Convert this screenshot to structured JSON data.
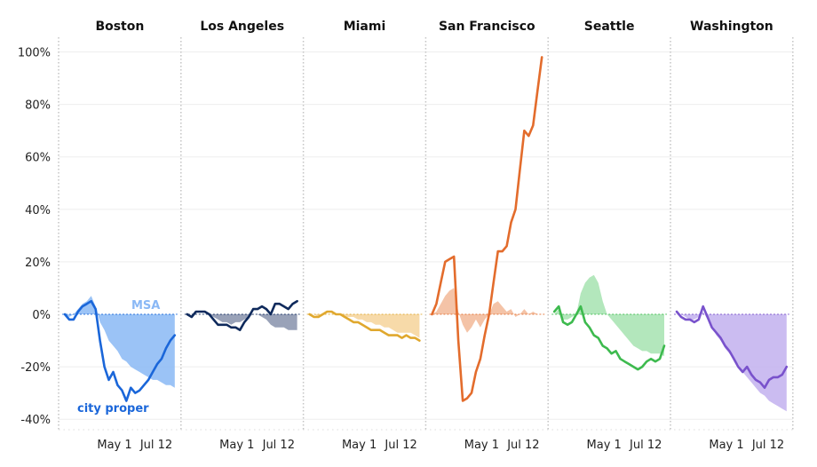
{
  "chart_data": {
    "type": "line",
    "title": "",
    "xlabel": "",
    "ylabel": "",
    "ylim": [
      -40,
      100
    ],
    "yticks": [
      "100%",
      "80%",
      "60%",
      "40%",
      "20%",
      "0%",
      "-20%",
      "-40%"
    ],
    "ytick_values": [
      100,
      80,
      60,
      40,
      20,
      0,
      -20,
      -40
    ],
    "xticks": [
      "May 1",
      "Jul 12"
    ],
    "grid": true,
    "annotations": {
      "msa": "MSA",
      "city": "city proper"
    },
    "series_description": "Per panel: line = city proper, shaded area = MSA; values are percent change, sampled evenly from early March to Jul 12",
    "panels": [
      {
        "name": "Boston",
        "color": "#1a66d9",
        "fill": "#8ab8f5",
        "city": [
          0,
          -2,
          -2,
          1,
          3,
          4,
          5,
          2,
          -10,
          -20,
          -25,
          -22,
          -27,
          -29,
          -33,
          -28,
          -30,
          -29,
          -27,
          -25,
          -22,
          -19,
          -17,
          -13,
          -10,
          -8
        ],
        "msa": [
          0,
          -1,
          0,
          2,
          4,
          5,
          7,
          3,
          -3,
          -6,
          -10,
          -12,
          -14,
          -17,
          -18,
          -20,
          -21,
          -22,
          -23,
          -24,
          -25,
          -25,
          -26,
          -27,
          -27,
          -28
        ]
      },
      {
        "name": "Los Angeles",
        "color": "#0f2a5c",
        "fill": "#8792ab",
        "city": [
          0,
          -1,
          1,
          1,
          1,
          0,
          -2,
          -4,
          -4,
          -4,
          -5,
          -5,
          -6,
          -3,
          -1,
          2,
          2,
          3,
          2,
          0,
          4,
          4,
          3,
          2,
          4,
          5
        ],
        "msa": [
          0,
          0,
          0,
          0,
          0,
          0,
          -1,
          -2,
          -3,
          -3,
          -4,
          -3,
          -3,
          -2,
          -1,
          0,
          0,
          -1,
          -2,
          -4,
          -5,
          -5,
          -5,
          -6,
          -6,
          -6
        ]
      },
      {
        "name": "Miami",
        "color": "#e0a82e",
        "fill": "#f6d49a",
        "city": [
          0,
          -1,
          -1,
          0,
          1,
          1,
          0,
          0,
          -1,
          -2,
          -3,
          -3,
          -4,
          -5,
          -6,
          -6,
          -6,
          -7,
          -8,
          -8,
          -8,
          -9,
          -8,
          -9,
          -9,
          -10
        ],
        "msa": [
          0,
          0,
          -1,
          0,
          0,
          0,
          0,
          0,
          -1,
          -1,
          -1,
          -2,
          -2,
          -3,
          -3,
          -4,
          -4,
          -5,
          -5,
          -6,
          -7,
          -7,
          -7,
          -7,
          -8,
          -9
        ]
      },
      {
        "name": "San Francisco",
        "color": "#e36c2c",
        "fill": "#f2b898",
        "city": [
          0,
          4,
          12,
          20,
          21,
          22,
          -10,
          -33,
          -32,
          -30,
          -22,
          -17,
          -8,
          0,
          12,
          24,
          24,
          26,
          35,
          40,
          55,
          70,
          68,
          72,
          85,
          98
        ],
        "msa": [
          0,
          1,
          4,
          7,
          9,
          10,
          1,
          -4,
          -7,
          -5,
          -2,
          -5,
          -2,
          0,
          4,
          5,
          3,
          1,
          2,
          -1,
          0,
          2,
          0,
          1,
          0,
          0
        ]
      },
      {
        "name": "Seattle",
        "color": "#3dba4e",
        "fill": "#a6e3b0",
        "city": [
          1,
          3,
          -3,
          -4,
          -3,
          0,
          3,
          -3,
          -5,
          -8,
          -9,
          -12,
          -13,
          -15,
          -14,
          -17,
          -18,
          -19,
          -20,
          -21,
          -20,
          -18,
          -17,
          -18,
          -17,
          -12
        ],
        "msa": [
          0,
          2,
          -2,
          -2,
          -1,
          0,
          8,
          12,
          14,
          15,
          12,
          5,
          0,
          -2,
          -4,
          -6,
          -8,
          -10,
          -12,
          -13,
          -14,
          -14,
          -15,
          -15,
          -15,
          -16
        ]
      },
      {
        "name": "Washington",
        "color": "#7952cc",
        "fill": "#c2b0ee",
        "city": [
          1,
          -1,
          -2,
          -2,
          -3,
          -2,
          3,
          -1,
          -5,
          -7,
          -9,
          -12,
          -14,
          -17,
          -20,
          -22,
          -20,
          -23,
          -25,
          -26,
          -28,
          -25,
          -24,
          -24,
          -23,
          -20
        ],
        "msa": [
          0,
          0,
          -1,
          -2,
          -2,
          -1,
          1,
          -2,
          -5,
          -8,
          -10,
          -13,
          -15,
          -17,
          -19,
          -22,
          -24,
          -26,
          -28,
          -30,
          -31,
          -33,
          -34,
          -35,
          -36,
          -37
        ]
      }
    ]
  }
}
